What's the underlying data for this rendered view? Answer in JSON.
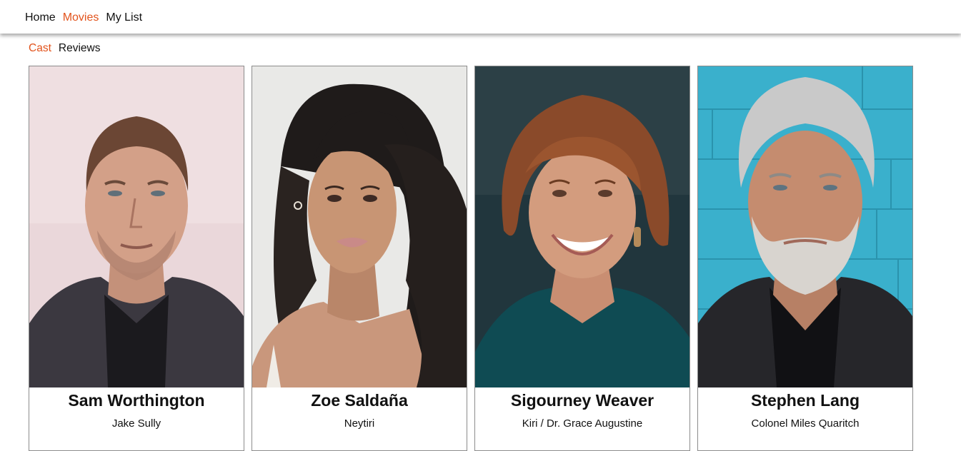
{
  "header": {
    "nav": [
      {
        "label": "Home",
        "active": false
      },
      {
        "label": "Movies",
        "active": true
      },
      {
        "label": "My List",
        "active": false
      }
    ]
  },
  "subnav": {
    "tabs": [
      {
        "label": "Cast",
        "active": true
      },
      {
        "label": "Reviews",
        "active": false
      }
    ]
  },
  "cast": [
    {
      "name": "Sam Worthington",
      "character": "Jake Sully"
    },
    {
      "name": "Zoe Saldaña",
      "character": "Neytiri"
    },
    {
      "name": "Sigourney Weaver",
      "character": "Kiri / Dr. Grace Augustine"
    },
    {
      "name": "Stephen Lang",
      "character": "Colonel Miles Quaritch"
    }
  ],
  "colors": {
    "accent": "#e2531c"
  }
}
